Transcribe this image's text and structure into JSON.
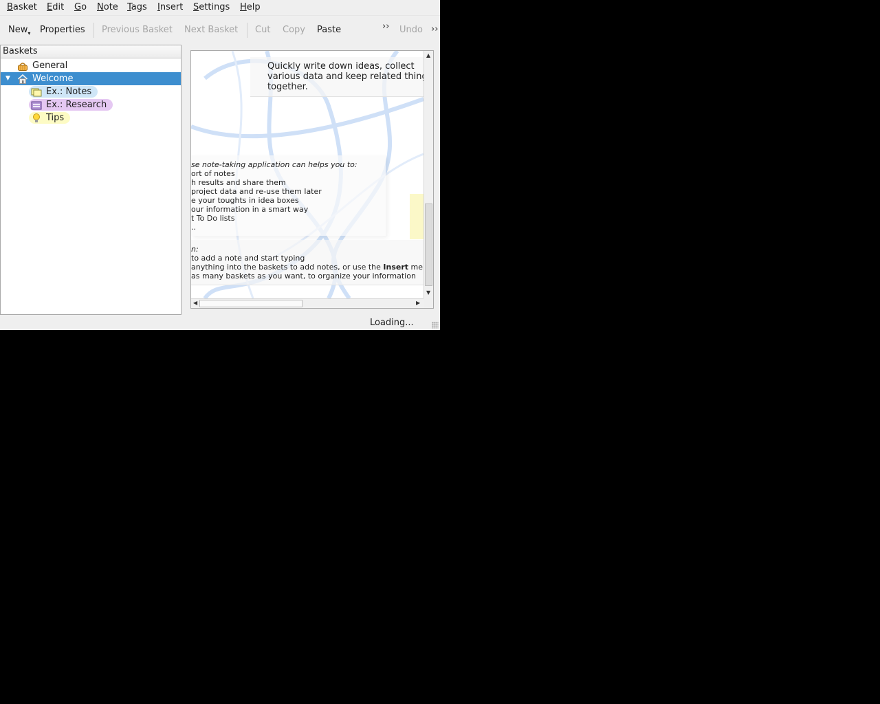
{
  "menubar": {
    "items": [
      {
        "mnemonic": "B",
        "rest": "asket"
      },
      {
        "mnemonic": "E",
        "rest": "dit"
      },
      {
        "mnemonic": "G",
        "rest": "o"
      },
      {
        "mnemonic": "N",
        "rest": "ote"
      },
      {
        "mnemonic": "T",
        "rest": "ags"
      },
      {
        "mnemonic": "I",
        "rest": "nsert"
      },
      {
        "mnemonic": "S",
        "rest": "ettings"
      },
      {
        "mnemonic": "H",
        "rest": "elp"
      }
    ]
  },
  "toolbar": {
    "new_label": "New",
    "properties_label": "Properties",
    "previous_basket_label": "Previous Basket",
    "next_basket_label": "Next Basket",
    "cut_label": "Cut",
    "copy_label": "Copy",
    "paste_label": "Paste",
    "undo_label": "Undo",
    "extension_glyph": "››"
  },
  "tree": {
    "header": "Baskets",
    "nodes": [
      {
        "label": "General",
        "icon": "basket-icon"
      },
      {
        "label": "Welcome",
        "icon": "home-icon",
        "selected": true
      },
      {
        "label": "Ex.: Notes",
        "icon": "notes-icon",
        "color": "#cfe6f7"
      },
      {
        "label": "Ex.: Research",
        "icon": "research-icon",
        "color": "#e5c8f2"
      },
      {
        "label": "Tips",
        "icon": "lightbulb-icon",
        "color": "#fdfbc4"
      }
    ]
  },
  "content": {
    "intro_lines": [
      "Quickly write down ideas, collect",
      "various data and keep related thing",
      "together."
    ],
    "features_heading": "se note-taking application can helps you to:",
    "features": [
      "ort of notes",
      "h results and share them",
      " project data and re-use them later",
      "e your toughts in idea boxes",
      "our information in a smart way",
      "t To Do lists",
      ".."
    ],
    "howto_heading": "n:",
    "howto_lines": [
      "to add a note and start typing",
      "anything into the baskets to add notes, or use the ",
      "as many baskets as you want, to organize your information"
    ],
    "insert_word": "Insert",
    "insert_suffix": " mer"
  },
  "status": {
    "text": "Loading..."
  }
}
